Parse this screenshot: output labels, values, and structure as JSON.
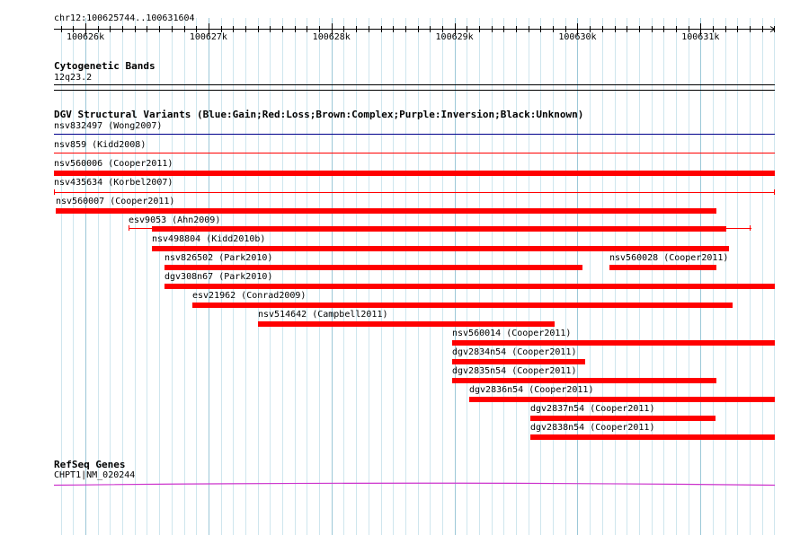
{
  "ruler": {
    "region": "chr12:100625744..100631604",
    "start": 100625744,
    "end": 100631604,
    "ticks": [
      {
        "pos": 100626000,
        "label": "100626k"
      },
      {
        "pos": 100627000,
        "label": "100627k"
      },
      {
        "pos": 100628000,
        "label": "100628k"
      },
      {
        "pos": 100629000,
        "label": "100629k"
      },
      {
        "pos": 100630000,
        "label": "100630k"
      },
      {
        "pos": 100631000,
        "label": "100631k"
      }
    ]
  },
  "tracks": {
    "cytoband": {
      "title": "Cytogenetic Bands",
      "band": "12q23.2"
    },
    "dgv": {
      "title": "DGV Structural Variants (Blue:Gain;Red:Loss;Brown:Complex;Purple:Inversion;Black:Unknown)",
      "colors": {
        "gain": "#00008b",
        "loss": "#ff0000"
      },
      "features": [
        {
          "label": "nsv832497 (Wong2007)",
          "type": "gain",
          "style": "line",
          "start": 100625744,
          "end": 100631604
        },
        {
          "label": "nsv859 (Kidd2008)",
          "type": "loss",
          "style": "line",
          "start": 100625744,
          "end": 100631604
        },
        {
          "label": "nsv560006 (Cooper2011)",
          "type": "loss",
          "style": "bar",
          "start": 100625744,
          "end": 100631604
        },
        {
          "label": "nsv435634 (Korbel2007)",
          "type": "loss",
          "style": "whisker",
          "start": 100625744,
          "end": 100631604
        },
        {
          "label": "nsv560007 (Cooper2011)",
          "type": "loss",
          "style": "bar",
          "start": 100625760,
          "end": 100631128
        },
        {
          "label": "esv9053 (Ahn2009)",
          "type": "loss",
          "style": "bar-whisker",
          "start": 100626350,
          "end": 100631410,
          "inner_start": 100626540,
          "inner_end": 100631210
        },
        {
          "label": "nsv498804 (Kidd2010b)",
          "type": "loss",
          "style": "bar",
          "start": 100626540,
          "end": 100631230
        },
        {
          "label": "nsv826502 (Park2010)",
          "type": "loss",
          "style": "bar",
          "start": 100626640,
          "end": 100630040
        },
        {
          "label": "nsv560028 (Cooper2011)",
          "type": "loss",
          "style": "bar",
          "start": 100630260,
          "end": 100631128,
          "same_row_as_previous": true
        },
        {
          "label": "dgv308n67 (Park2010)",
          "type": "loss",
          "style": "bar",
          "start": 100626640,
          "end": 100631604
        },
        {
          "label": "esv21962 (Conrad2009)",
          "type": "loss",
          "style": "bar",
          "start": 100626870,
          "end": 100631260
        },
        {
          "label": "nsv514642 (Campbell2011)",
          "type": "loss",
          "style": "bar",
          "start": 100627400,
          "end": 100629810
        },
        {
          "label": "nsv560014 (Cooper2011)",
          "type": "loss",
          "style": "bar",
          "start": 100628980,
          "end": 100631604
        },
        {
          "label": "dgv2834n54 (Cooper2011)",
          "type": "loss",
          "style": "bar",
          "start": 100628980,
          "end": 100630060
        },
        {
          "label": "dgv2835n54 (Cooper2011)",
          "type": "loss",
          "style": "bar",
          "start": 100628980,
          "end": 100631128
        },
        {
          "label": "dgv2836n54 (Cooper2011)",
          "type": "loss",
          "style": "bar",
          "start": 100629120,
          "end": 100631604
        },
        {
          "label": "dgv2837n54 (Cooper2011)",
          "type": "loss",
          "style": "bar",
          "start": 100629620,
          "end": 100631128
        },
        {
          "label": "dgv2838n54 (Cooper2011)",
          "type": "loss",
          "style": "bar",
          "start": 100629620,
          "end": 100631604
        }
      ]
    },
    "refseq": {
      "title": "RefSeq Genes",
      "gene": "CHPT1|NM_020244",
      "color": "#cc33cc"
    }
  }
}
